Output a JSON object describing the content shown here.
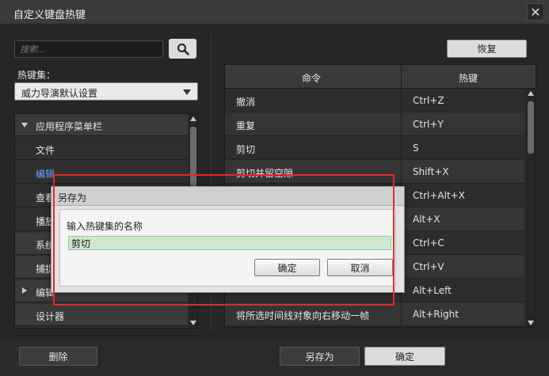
{
  "window": {
    "title": "自定义键盘热键",
    "close_glyph": "✕"
  },
  "search": {
    "placeholder": "搜索..."
  },
  "keyset": {
    "label": "热键集：",
    "selected": "威力导演默认设置"
  },
  "tree": {
    "items": [
      {
        "label": "应用程序菜单栏",
        "type": "category",
        "expanded": true
      },
      {
        "label": "文件",
        "type": "item"
      },
      {
        "label": "编辑",
        "type": "item",
        "selected": true
      },
      {
        "label": "查看",
        "type": "item"
      },
      {
        "label": "播放",
        "type": "item"
      },
      {
        "label": "系统",
        "type": "category"
      },
      {
        "label": "捕捉",
        "type": "category"
      },
      {
        "label": "编辑",
        "type": "category",
        "expanded": false
      },
      {
        "label": "设计器",
        "type": "category"
      }
    ]
  },
  "restore_button": "恢复",
  "grid": {
    "headers": {
      "command": "命令",
      "hotkey": "热键"
    },
    "rows": [
      {
        "command": "撤消",
        "hotkey": "Ctrl+Z"
      },
      {
        "command": "重复",
        "hotkey": "Ctrl+Y"
      },
      {
        "command": "剪切",
        "hotkey": "S"
      },
      {
        "command": "剪切并留空隙",
        "hotkey": "Shift+X"
      },
      {
        "command": "",
        "hotkey": "Ctrl+Alt+X"
      },
      {
        "command": "",
        "hotkey": "Alt+X"
      },
      {
        "command": "",
        "hotkey": "Ctrl+C"
      },
      {
        "command": "",
        "hotkey": "Ctrl+V"
      },
      {
        "command": "",
        "hotkey": "Alt+Left"
      },
      {
        "command": "将所选时间线对象向右移动一帧",
        "hotkey": "Alt+Right"
      }
    ]
  },
  "footer": {
    "delete_label": "删除",
    "save_as_label": "另存为",
    "ok_label": "确定"
  },
  "dialog": {
    "title": "另存为",
    "prompt": "输入热键集的名称",
    "input_value": "剪切",
    "ok_label": "确定",
    "cancel_label": "取消"
  },
  "colors": {
    "highlight_box": "#e3292b",
    "selected_text": "#6ea3ff",
    "input_selection": "#cfe8cf"
  }
}
